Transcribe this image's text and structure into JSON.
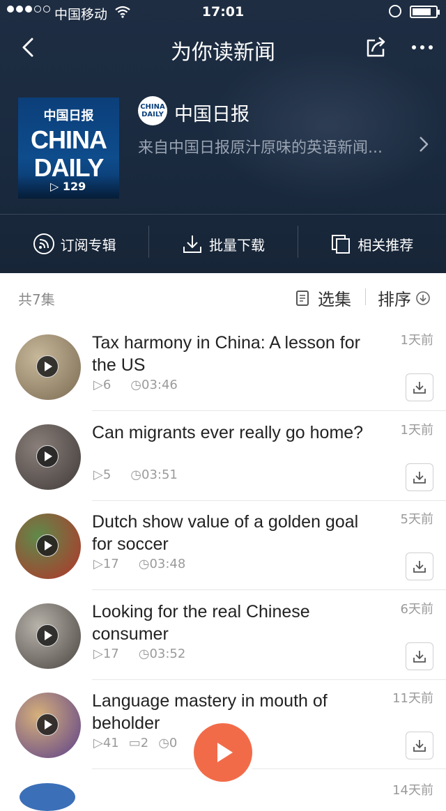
{
  "status_bar": {
    "carrier": "中国移动",
    "time": "17:01"
  },
  "nav": {
    "title": "为你读新闻"
  },
  "album": {
    "cover_cn": "中国日报",
    "cover_line1": "CHINA",
    "cover_line2": "DAILY",
    "play_count": "▷ 129",
    "logo_line1": "CHINA",
    "logo_line2": "DAILY",
    "channel_name": "中国日报",
    "description": "来自中国日报原汁原味的英语新闻..."
  },
  "actions": [
    {
      "label": "订阅专辑",
      "icon": "rss-icon"
    },
    {
      "label": "批量下载",
      "icon": "download-icon"
    },
    {
      "label": "相关推荐",
      "icon": "copy-icon"
    }
  ],
  "list": {
    "count": "共7集",
    "select_label": "选集",
    "sort_label": "排序"
  },
  "episodes": [
    {
      "title": "Tax harmony in China: A lesson for the US",
      "plays": "▷6",
      "duration": "◷03:46",
      "comments": "",
      "date": "1天前",
      "colors": [
        "#c8b89a",
        "#7a6a52"
      ]
    },
    {
      "title": "Can migrants ever really go home?",
      "plays": "▷5",
      "duration": "◷03:51",
      "comments": "",
      "date": "1天前",
      "colors": [
        "#8a7f7a",
        "#3f3a38"
      ]
    },
    {
      "title": "Dutch show value of a golden goal for soccer",
      "plays": "▷17",
      "duration": "◷03:48",
      "comments": "",
      "date": "5天前",
      "colors": [
        "#5f8a4a",
        "#b4332a"
      ]
    },
    {
      "title": "Looking for the real Chinese consumer",
      "plays": "▷17",
      "duration": "◷03:52",
      "comments": "",
      "date": "6天前",
      "colors": [
        "#b7b2aa",
        "#4a4440"
      ]
    },
    {
      "title": "Language mastery in mouth of beholder",
      "plays": "▷41",
      "duration": "◷0",
      "comments": "▭2",
      "date": "11天前",
      "colors": [
        "#d6b07a",
        "#5b3f8a"
      ]
    }
  ],
  "next_episode": {
    "date": "14天前"
  }
}
